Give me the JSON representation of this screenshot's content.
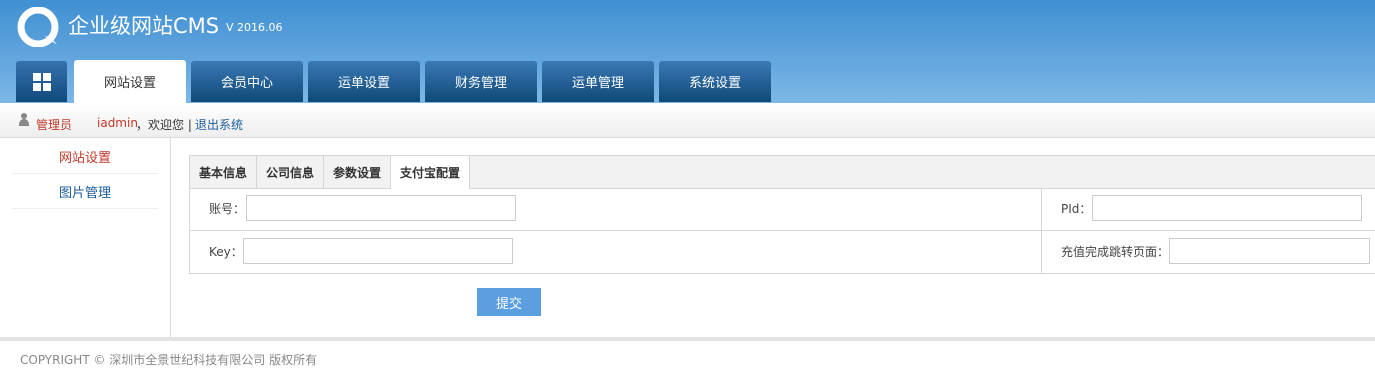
{
  "header": {
    "title": "企业级网站CMS",
    "version": "V 2016.06",
    "brand_color": "#3f8fd2"
  },
  "nav": {
    "home_icon": "grid-icon",
    "tabs": [
      {
        "label": "网站设置",
        "active": true
      },
      {
        "label": "会员中心",
        "active": false
      },
      {
        "label": "运单设置",
        "active": false
      },
      {
        "label": "财务管理",
        "active": false
      },
      {
        "label": "运单管理",
        "active": false
      },
      {
        "label": "系统设置",
        "active": false
      }
    ]
  },
  "userbar": {
    "icon": "user-icon",
    "role": "管理员",
    "username": "iadmin",
    "welcome": "，欢迎您 |",
    "logout": "退出系统"
  },
  "sidebar": {
    "items": [
      {
        "label": "网站设置",
        "active": true
      },
      {
        "label": "图片管理",
        "active": false
      }
    ]
  },
  "subtabs": [
    {
      "label": "基本信息",
      "active": false
    },
    {
      "label": "公司信息",
      "active": false
    },
    {
      "label": "参数设置",
      "active": false
    },
    {
      "label": "支付宝配置",
      "active": true
    }
  ],
  "form": {
    "account_label": "账号：",
    "account_value": "",
    "pid_label": "PId：",
    "pid_value": "",
    "key_label": "Key：",
    "key_value": "",
    "redirect_label": "充值完成跳转页面：",
    "redirect_value": "",
    "submit_label": "提交"
  },
  "footer": {
    "copyright": "COPYRIGHT © 深圳市全景世纪科技有限公司 版权所有"
  }
}
